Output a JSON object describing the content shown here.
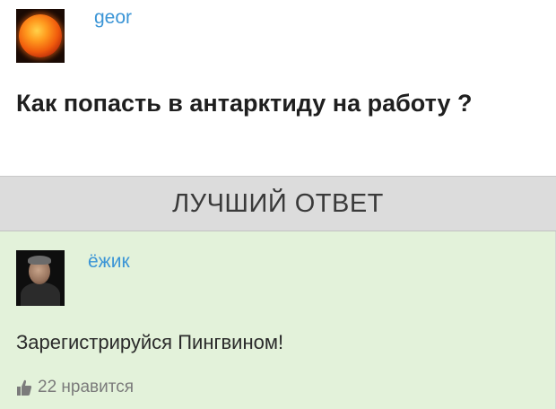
{
  "question": {
    "author": "geor",
    "title": "Как попасть в антарктиду на работу ?"
  },
  "best_answer_header": "ЛУЧШИЙ ОТВЕТ",
  "answer": {
    "author": "ёжик",
    "text": "Зарегистрируйся Пингвином!",
    "likes": "22 нравится"
  },
  "icons": {
    "question_avatar": "sun-avatar-icon",
    "answer_avatar": "user-photo-avatar-icon",
    "like": "thumbs-up-icon"
  },
  "colors": {
    "author_link": "#3b95d6",
    "best_bar_bg": "#dcdcdc",
    "answer_bg": "#e3f2da"
  }
}
